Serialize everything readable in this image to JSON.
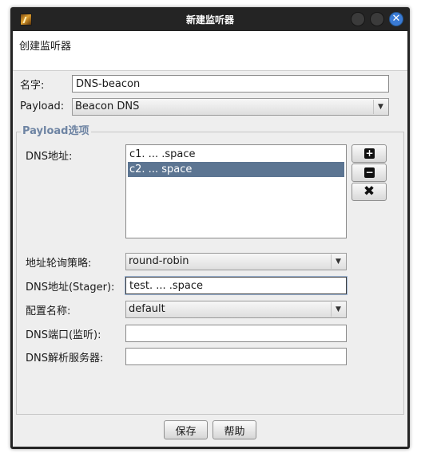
{
  "window": {
    "title": "新建监听器"
  },
  "header": {
    "text": "创建监听器"
  },
  "form": {
    "name_label": "名字:",
    "name_value": "DNS-beacon",
    "payload_label": "Payload:",
    "payload_value": "Beacon DNS"
  },
  "payload_options": {
    "title": "Payload选项",
    "dns_hosts_label": "DNS地址:",
    "dns_hosts": [
      "c1. ... .space",
      "c2. ... space"
    ],
    "selected_index": 1,
    "add_icon": "plus-icon",
    "remove_icon": "minus-icon",
    "clear_icon": "x-icon",
    "rotation_label": "地址轮询策略:",
    "rotation_value": "round-robin",
    "stager_label": "DNS地址(Stager):",
    "stager_value": "test. ... .space",
    "profile_label": "配置名称:",
    "profile_value": "default",
    "port_label": "DNS端口(监听):",
    "port_value": "",
    "resolver_label": "DNS解析服务器:",
    "resolver_value": ""
  },
  "buttons": {
    "save": "保存",
    "help": "帮助"
  },
  "colors": {
    "selection": "#5c7592",
    "section_title": "#6e84a3",
    "close_button": "#3a7bd5"
  }
}
